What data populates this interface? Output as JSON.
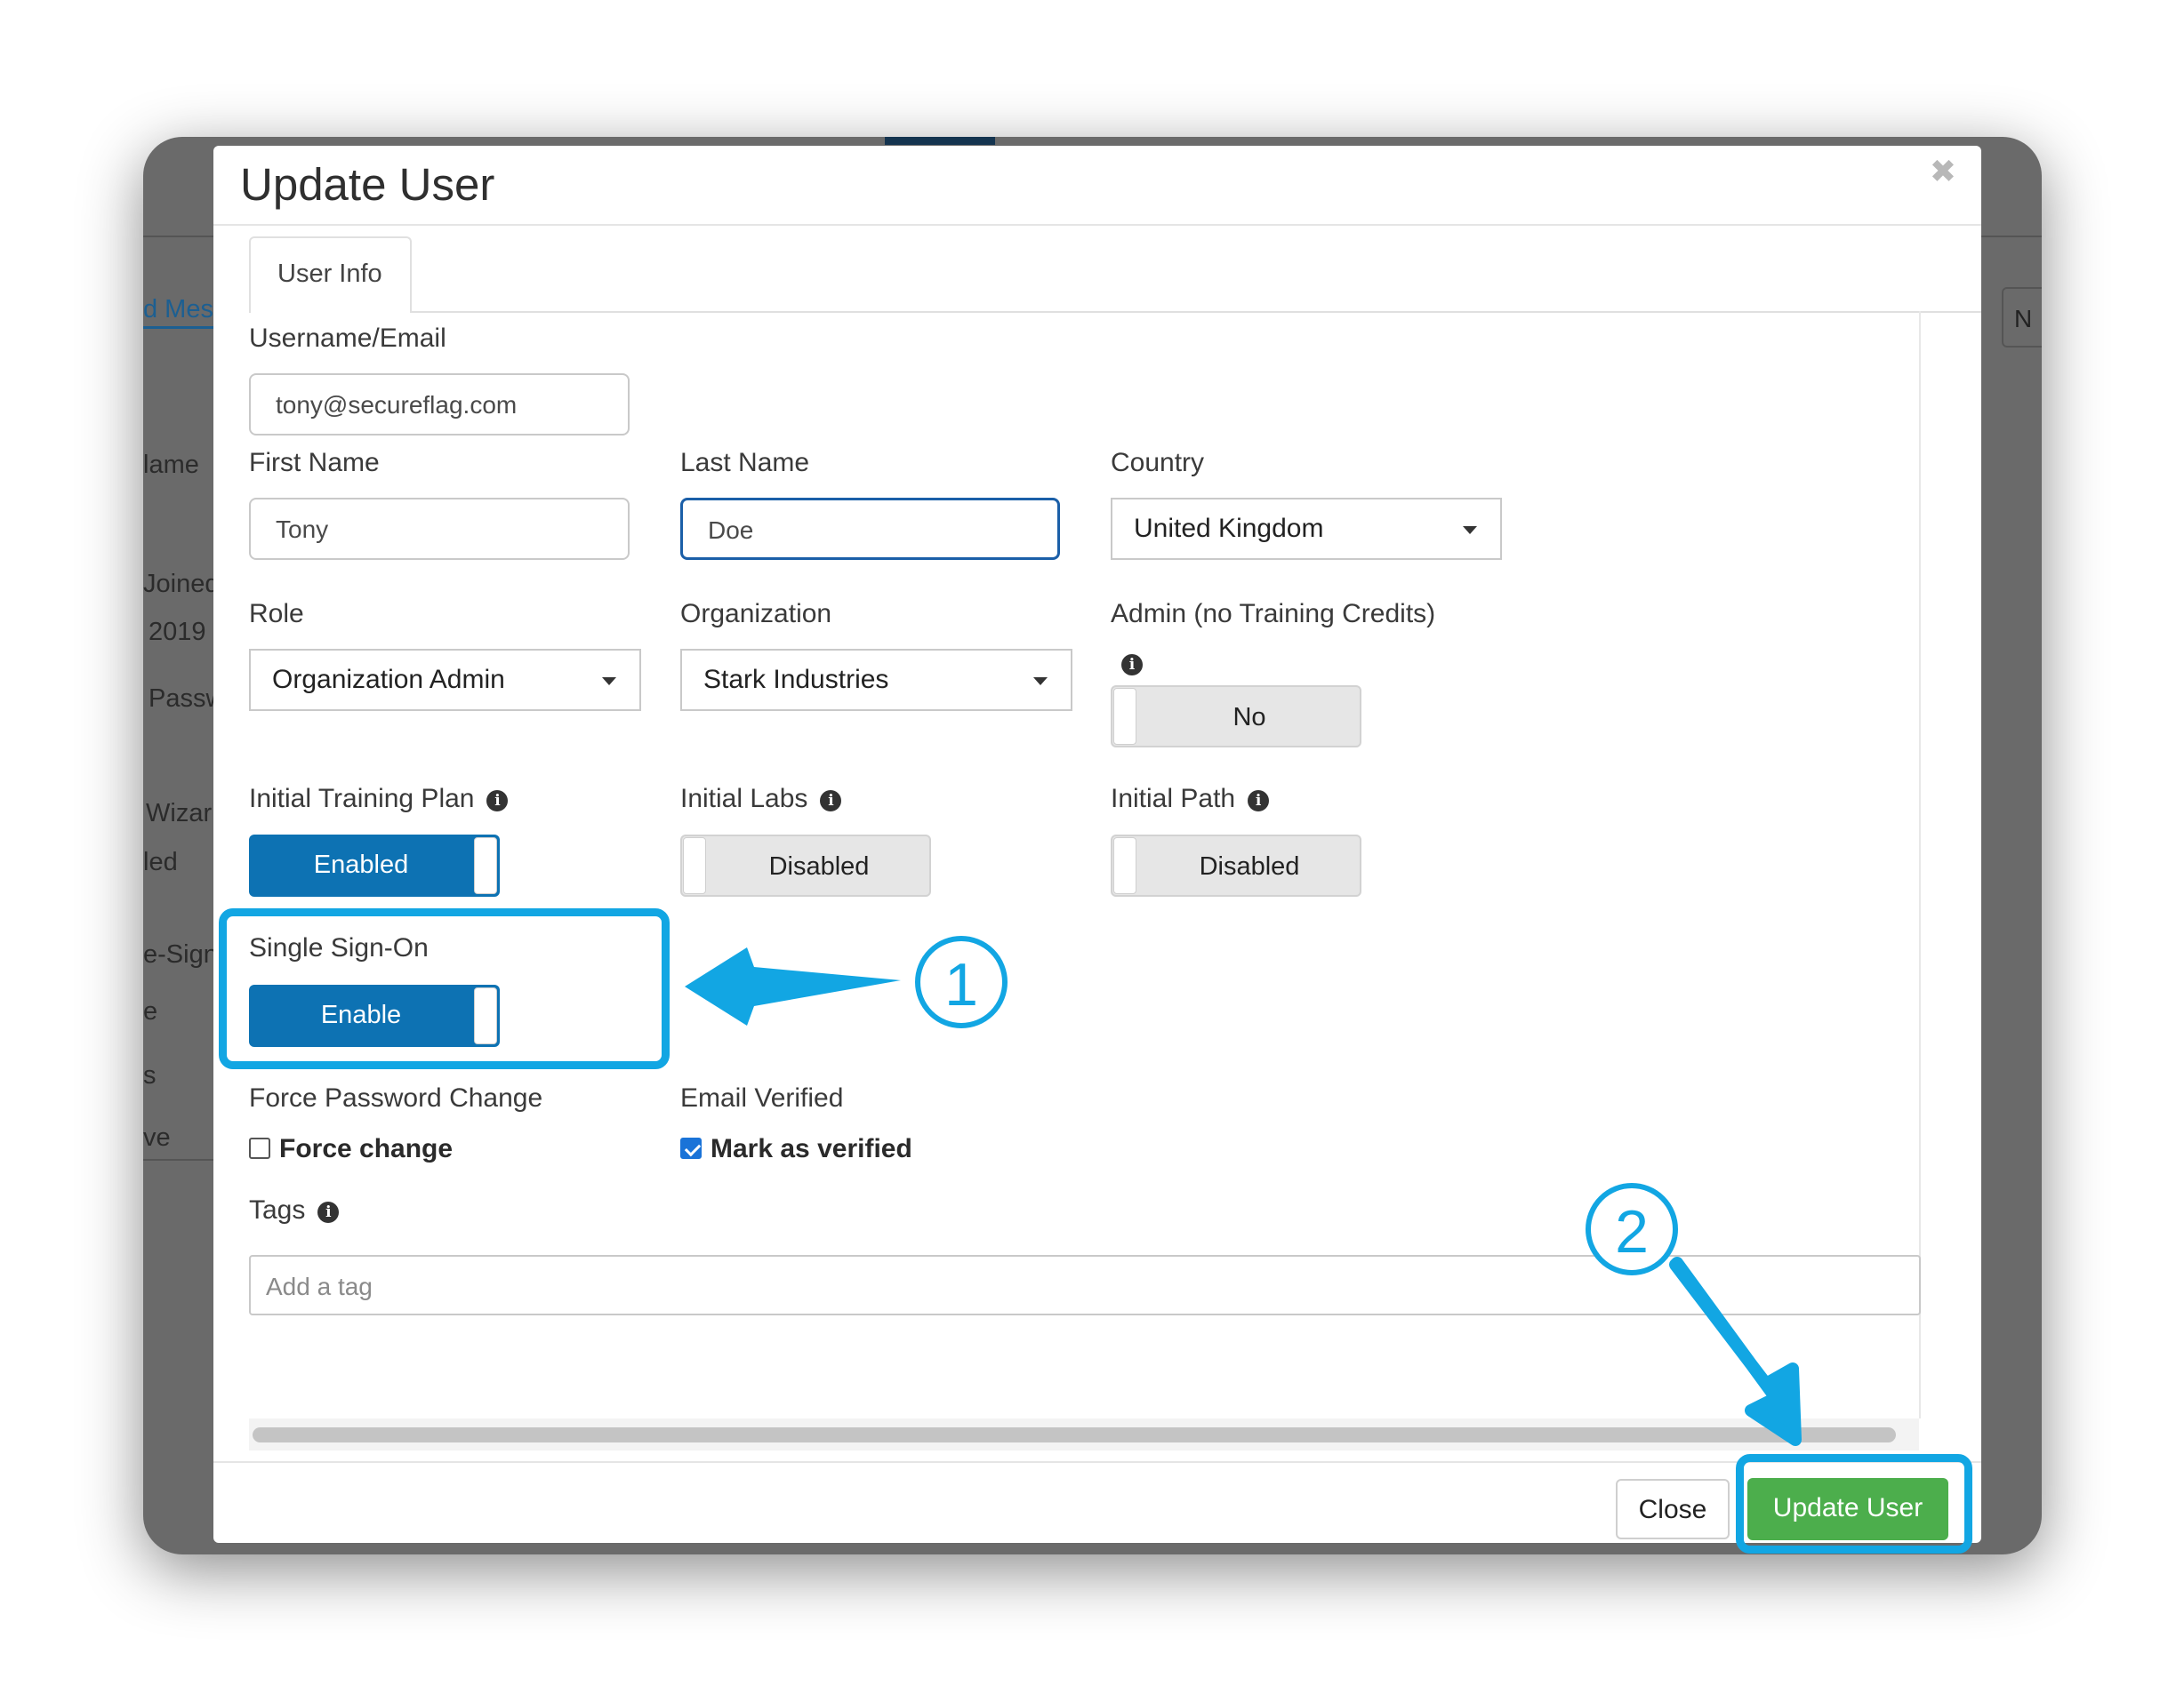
{
  "background": {
    "fragments": [
      "d Mes",
      "lame",
      "Joined",
      "2019 1",
      "Passw",
      "Wizar",
      "led",
      "e-Sign",
      "e",
      "s",
      "ve",
      "N"
    ]
  },
  "modal": {
    "title": "Update User",
    "close_glyph": "✖",
    "tab_label": "User Info",
    "username": {
      "label": "Username/Email",
      "value": "tony@secureflag.com"
    },
    "first_name": {
      "label": "First Name",
      "value": "Tony"
    },
    "last_name": {
      "label": "Last Name",
      "value": "Doe"
    },
    "country": {
      "label": "Country",
      "value": "United Kingdom"
    },
    "role": {
      "label": "Role",
      "value": "Organization Admin"
    },
    "organization": {
      "label": "Organization",
      "value": "Stark Industries"
    },
    "admin_no_credits": {
      "label": "Admin (no Training Credits)",
      "toggle_label": "No",
      "enabled": false
    },
    "initial_training_plan": {
      "label": "Initial Training Plan",
      "toggle_label": "Enabled",
      "enabled": true
    },
    "initial_labs": {
      "label": "Initial Labs",
      "toggle_label": "Disabled",
      "enabled": false
    },
    "initial_path": {
      "label": "Initial Path",
      "toggle_label": "Disabled",
      "enabled": false
    },
    "single_sign_on": {
      "label": "Single Sign-On",
      "toggle_label": "Enable",
      "enabled": true
    },
    "force_password_change": {
      "label": "Force Password Change",
      "checkbox_label": "Force change",
      "checked": false
    },
    "email_verified": {
      "label": "Email Verified",
      "checkbox_label": "Mark as verified",
      "checked": true
    },
    "tags": {
      "label": "Tags",
      "placeholder": "Add a tag"
    },
    "info_glyph": "i",
    "footer": {
      "close_label": "Close",
      "update_label": "Update User"
    }
  },
  "annotations": {
    "callout_1": "1",
    "callout_2": "2",
    "color": "#12a6e3"
  },
  "colors": {
    "toggle_on": "#0d72b3",
    "update_button": "#4cae4c",
    "focus_border": "#1b5fa8"
  }
}
